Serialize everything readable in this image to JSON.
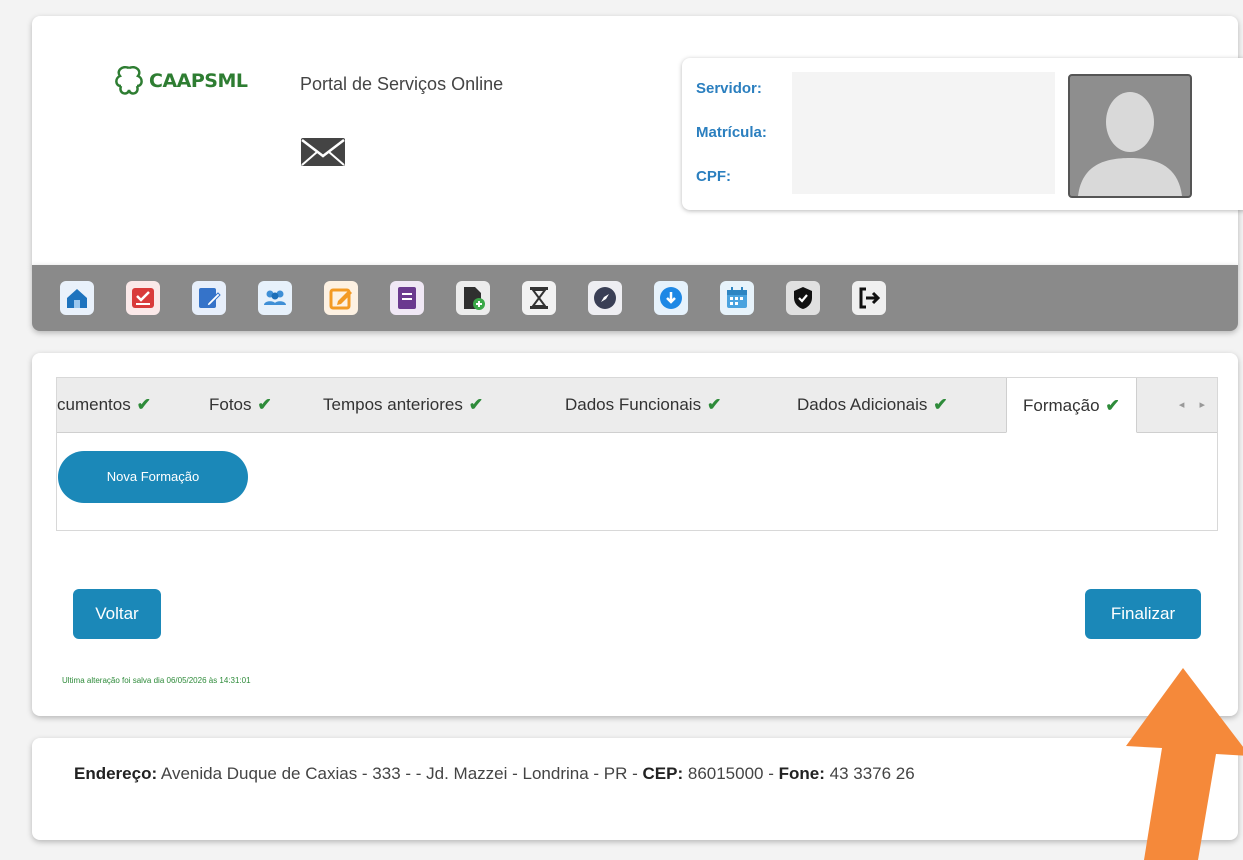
{
  "header": {
    "logo_text": "CAAPSML",
    "portal_title": "Portal de Serviços Online",
    "info": {
      "servidor_label": "Servidor:",
      "matricula_label": "Matrícula:",
      "cpf_label": "CPF:"
    }
  },
  "toolbar": {
    "buttons": [
      {
        "icon": "home-icon",
        "color": "#1e73be"
      },
      {
        "icon": "inbox-check-icon",
        "color": "#d93b3b"
      },
      {
        "icon": "edit-document-icon",
        "color": "#3573c9"
      },
      {
        "icon": "users-icon",
        "color": "#3f8fd6"
      },
      {
        "icon": "pencil-square-icon",
        "color": "#f39a24"
      },
      {
        "icon": "book-icon",
        "color": "#6b3a8f"
      },
      {
        "icon": "file-add-icon",
        "color": "#2f2f2f"
      },
      {
        "icon": "hourglass-icon",
        "color": "#e9e9e9"
      },
      {
        "icon": "compass-icon",
        "color": "#3a3f55"
      },
      {
        "icon": "download-icon",
        "color": "#1e88e5"
      },
      {
        "icon": "calendar-icon",
        "color": "#4aa3df"
      },
      {
        "icon": "shield-check-icon",
        "color": "#111111"
      },
      {
        "icon": "sign-out-icon",
        "color": "#111111"
      }
    ]
  },
  "tabs": [
    {
      "label": "cumentos"
    },
    {
      "label": "Fotos"
    },
    {
      "label": "Tempos anteriores"
    },
    {
      "label": "Dados Funcionais"
    },
    {
      "label": "Dados Adicionais"
    },
    {
      "label": "Formação",
      "active": true
    }
  ],
  "tab_check": "✔",
  "tab_arrows": "◂ ▸",
  "content": {
    "new_button": "Nova Formação",
    "back_button": "Voltar",
    "finish_button": "Finalizar",
    "saved_note": "Ultima alteração foi salva dia 06/05/2026 às 14:31:01"
  },
  "footer": {
    "endereco_label": "Endereço:",
    "endereco_value": " Avenida Duque de Caxias - 333 - - Jd. Mazzei - Londrina - PR - ",
    "cep_label": "CEP:",
    "cep_value": " 86015000 - ",
    "fone_label": "Fone:",
    "fone_value": " 43 3376 26"
  },
  "colors": {
    "primary": "#1b88b8",
    "label_blue": "#2b7fbf",
    "check_green": "#2e8b3a",
    "toolbar_gray": "#8a8a8a",
    "arrow_orange": "#f5893a"
  }
}
